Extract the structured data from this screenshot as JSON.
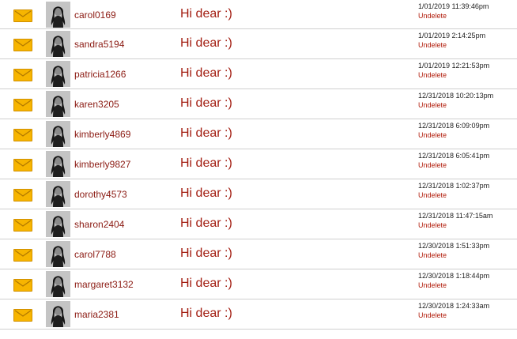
{
  "messages": [
    {
      "user": "carol0169",
      "subject": "Hi dear :)",
      "date": "1/01/2019 11:39:46pm",
      "action": "Undelete",
      "icon": "envelope-icon"
    },
    {
      "user": "sandra5194",
      "subject": "Hi dear :)",
      "date": "1/01/2019 2:14:25pm",
      "action": "Undelete",
      "icon": "envelope-icon"
    },
    {
      "user": "patricia1266",
      "subject": "Hi dear :)",
      "date": "1/01/2019 12:21:53pm",
      "action": "Undelete",
      "icon": "envelope-icon"
    },
    {
      "user": "karen3205",
      "subject": "Hi dear :)",
      "date": "12/31/2018 10:20:13pm",
      "action": "Undelete",
      "icon": "envelope-icon"
    },
    {
      "user": "kimberly4869",
      "subject": "Hi dear :)",
      "date": "12/31/2018 6:09:09pm",
      "action": "Undelete",
      "icon": "envelope-icon"
    },
    {
      "user": "kimberly9827",
      "subject": "Hi dear :)",
      "date": "12/31/2018 6:05:41pm",
      "action": "Undelete",
      "icon": "envelope-icon"
    },
    {
      "user": "dorothy4573",
      "subject": "Hi dear :)",
      "date": "12/31/2018 1:02:37pm",
      "action": "Undelete",
      "icon": "envelope-icon"
    },
    {
      "user": "sharon2404",
      "subject": "Hi dear :)",
      "date": "12/31/2018 11:47:15am",
      "action": "Undelete",
      "icon": "envelope-icon"
    },
    {
      "user": "carol7788",
      "subject": "Hi dear :)",
      "date": "12/30/2018 1:51:33pm",
      "action": "Undelete",
      "icon": "envelope-icon"
    },
    {
      "user": "margaret3132",
      "subject": "Hi dear :)",
      "date": "12/30/2018 1:18:44pm",
      "action": "Undelete",
      "icon": "envelope-icon"
    },
    {
      "user": "maria2381",
      "subject": "Hi dear :)",
      "date": "12/30/2018 1:24:33am",
      "action": "Undelete",
      "icon": "envelope-icon"
    }
  ],
  "colors": {
    "accent": "#a21c10",
    "envelope": "#f7b500",
    "divider": "#cfcfcf"
  }
}
